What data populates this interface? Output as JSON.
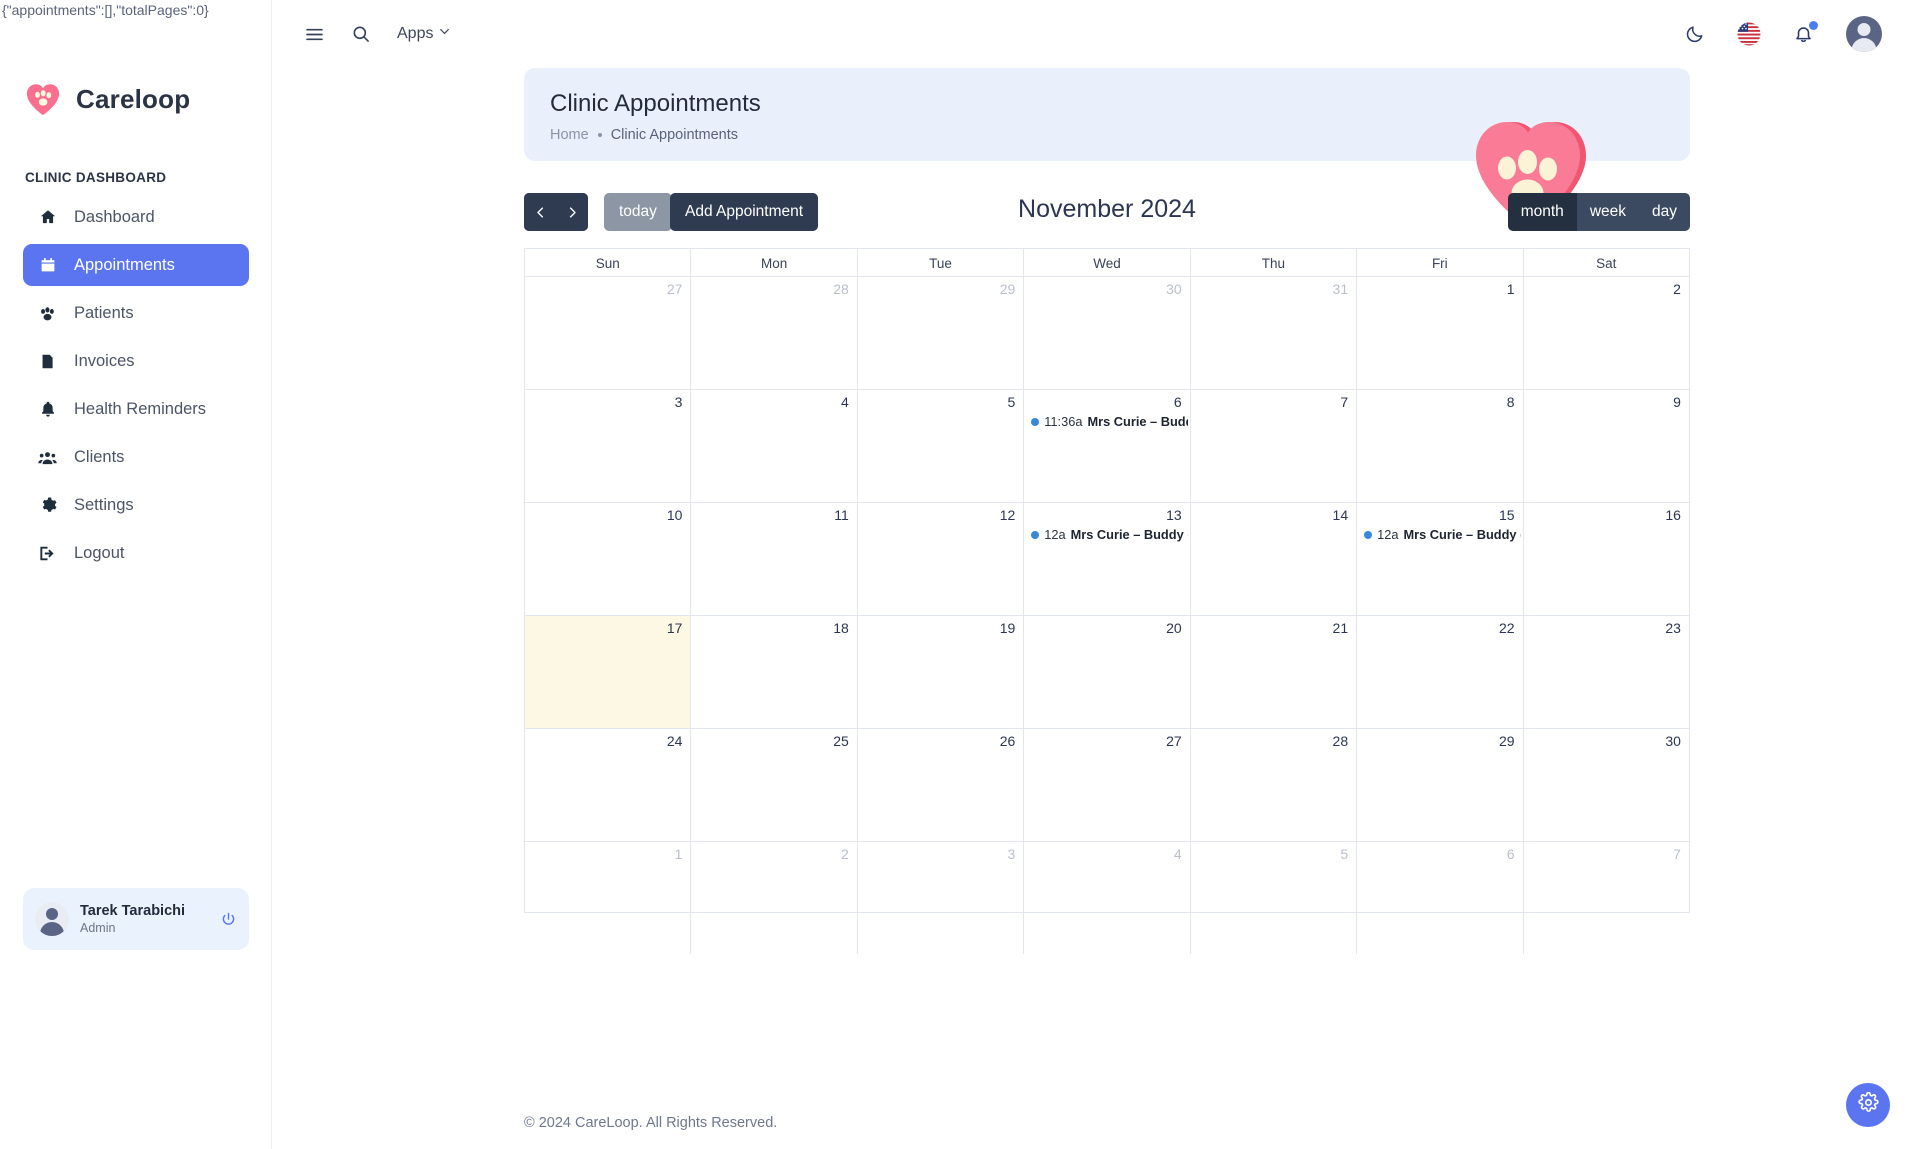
{
  "debug_echo": "{\"appointments\":[],\"totalPages\":0}",
  "brand": {
    "name": "Careloop",
    "logo_icon": "heart-paw-logo-icon"
  },
  "sidebar": {
    "section_title": "CLINIC DASHBOARD",
    "items": [
      {
        "label": "Dashboard",
        "icon": "home-icon",
        "active": false
      },
      {
        "label": "Appointments",
        "icon": "calendar-icon",
        "active": true
      },
      {
        "label": "Patients",
        "icon": "paw-icon",
        "active": false
      },
      {
        "label": "Invoices",
        "icon": "invoice-icon",
        "active": false
      },
      {
        "label": "Health Reminders",
        "icon": "bell-icon",
        "active": false
      },
      {
        "label": "Clients",
        "icon": "users-icon",
        "active": false
      },
      {
        "label": "Settings",
        "icon": "gear-icon",
        "active": false
      },
      {
        "label": "Logout",
        "icon": "logout-icon",
        "active": false
      }
    ],
    "user": {
      "name": "Tarek Tarabichi",
      "role": "Admin",
      "power_icon": "power-icon",
      "avatar": "user-avatar"
    }
  },
  "topbar": {
    "menu_icon": "hamburger-menu-icon",
    "search_icon": "search-icon",
    "apps_label": "Apps",
    "apps_caret_icon": "chevron-down-icon",
    "theme_icon": "moon-icon",
    "language_icon": "us-flag-icon",
    "notifications_icon": "bell-icon",
    "notifications_badge": true,
    "avatar_icon": "user-avatar-icon"
  },
  "header": {
    "title": "Clinic Appointments",
    "breadcrumb": {
      "home": "Home",
      "current": "Clinic Appointments"
    },
    "art_icon": "heart-paw-illustration"
  },
  "calendar_toolbar": {
    "prev_icon": "chevron-left-icon",
    "next_icon": "chevron-right-icon",
    "today_label": "today",
    "add_label": "Add Appointment",
    "title": "November 2024",
    "views": [
      {
        "label": "month",
        "active": true
      },
      {
        "label": "week",
        "active": false
      },
      {
        "label": "day",
        "active": false
      }
    ]
  },
  "calendar": {
    "day_headers": [
      "Sun",
      "Mon",
      "Tue",
      "Wed",
      "Thu",
      "Fri",
      "Sat"
    ],
    "weeks": [
      [
        {
          "num": "27",
          "other": true,
          "today": false,
          "events": []
        },
        {
          "num": "28",
          "other": true,
          "today": false,
          "events": []
        },
        {
          "num": "29",
          "other": true,
          "today": false,
          "events": []
        },
        {
          "num": "30",
          "other": true,
          "today": false,
          "events": []
        },
        {
          "num": "31",
          "other": true,
          "today": false,
          "events": []
        },
        {
          "num": "1",
          "other": false,
          "today": false,
          "events": []
        },
        {
          "num": "2",
          "other": false,
          "today": false,
          "events": []
        }
      ],
      [
        {
          "num": "3",
          "other": false,
          "today": false,
          "events": []
        },
        {
          "num": "4",
          "other": false,
          "today": false,
          "events": []
        },
        {
          "num": "5",
          "other": false,
          "today": false,
          "events": []
        },
        {
          "num": "6",
          "other": false,
          "today": false,
          "events": [
            {
              "time": "11:36a",
              "title": "Mrs Curie – Buddy"
            }
          ]
        },
        {
          "num": "7",
          "other": false,
          "today": false,
          "events": []
        },
        {
          "num": "8",
          "other": false,
          "today": false,
          "events": []
        },
        {
          "num": "9",
          "other": false,
          "today": false,
          "events": []
        }
      ],
      [
        {
          "num": "10",
          "other": false,
          "today": false,
          "events": []
        },
        {
          "num": "11",
          "other": false,
          "today": false,
          "events": []
        },
        {
          "num": "12",
          "other": false,
          "today": false,
          "events": []
        },
        {
          "num": "13",
          "other": false,
          "today": false,
          "events": [
            {
              "time": "12a",
              "title": "Mrs Curie – Buddy (Gr"
            }
          ]
        },
        {
          "num": "14",
          "other": false,
          "today": false,
          "events": []
        },
        {
          "num": "15",
          "other": false,
          "today": false,
          "events": [
            {
              "time": "12a",
              "title": "Mrs Curie – Buddy (Gr"
            }
          ]
        },
        {
          "num": "16",
          "other": false,
          "today": false,
          "events": []
        }
      ],
      [
        {
          "num": "17",
          "other": false,
          "today": true,
          "events": []
        },
        {
          "num": "18",
          "other": false,
          "today": false,
          "events": []
        },
        {
          "num": "19",
          "other": false,
          "today": false,
          "events": []
        },
        {
          "num": "20",
          "other": false,
          "today": false,
          "events": []
        },
        {
          "num": "21",
          "other": false,
          "today": false,
          "events": []
        },
        {
          "num": "22",
          "other": false,
          "today": false,
          "events": []
        },
        {
          "num": "23",
          "other": false,
          "today": false,
          "events": []
        }
      ],
      [
        {
          "num": "24",
          "other": false,
          "today": false,
          "events": []
        },
        {
          "num": "25",
          "other": false,
          "today": false,
          "events": []
        },
        {
          "num": "26",
          "other": false,
          "today": false,
          "events": []
        },
        {
          "num": "27",
          "other": false,
          "today": false,
          "events": []
        },
        {
          "num": "28",
          "other": false,
          "today": false,
          "events": []
        },
        {
          "num": "29",
          "other": false,
          "today": false,
          "events": []
        },
        {
          "num": "30",
          "other": false,
          "today": false,
          "events": []
        }
      ],
      [
        {
          "num": "1",
          "other": true,
          "today": false,
          "events": []
        },
        {
          "num": "2",
          "other": true,
          "today": false,
          "events": []
        },
        {
          "num": "3",
          "other": true,
          "today": false,
          "events": []
        },
        {
          "num": "4",
          "other": true,
          "today": false,
          "events": []
        },
        {
          "num": "5",
          "other": true,
          "today": false,
          "events": []
        },
        {
          "num": "6",
          "other": true,
          "today": false,
          "events": []
        },
        {
          "num": "7",
          "other": true,
          "today": false,
          "events": []
        }
      ]
    ]
  },
  "footer": {
    "text": "© 2024 CareLoop. All Rights Reserved."
  },
  "fab": {
    "icon": "gear-icon"
  },
  "colors": {
    "accent": "#5b75f0",
    "dark": "#2f3b50",
    "today_bg": "#fcf8e3",
    "header_bg": "#e9f0fc",
    "event_dot": "#3788d8",
    "brand_pink": "#fa6f8e"
  }
}
